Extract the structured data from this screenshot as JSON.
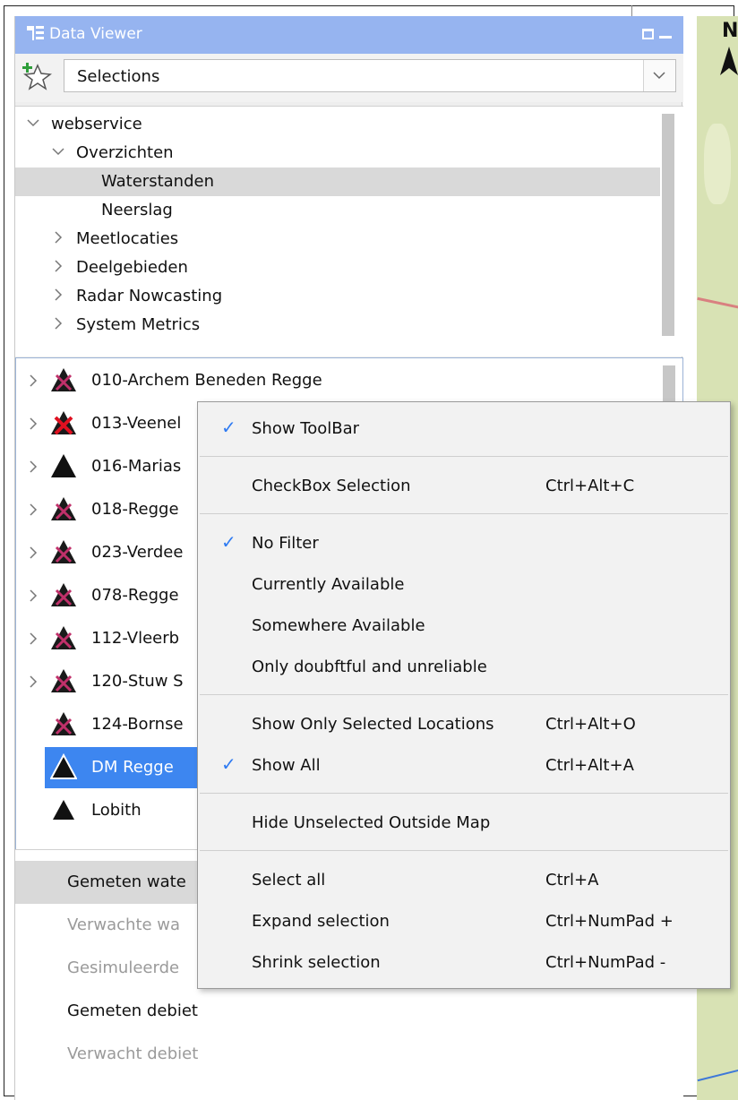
{
  "panel": {
    "title": "Data Viewer",
    "selector_value": "Selections"
  },
  "tree": [
    {
      "label": "webservice",
      "expanded": true
    },
    {
      "label": "Overzichten",
      "expanded": true
    },
    {
      "label": "Waterstanden",
      "selected": true
    },
    {
      "label": "Neerslag"
    },
    {
      "label": "Meetlocaties",
      "expanded": false
    },
    {
      "label": "Deelgebieden",
      "expanded": false
    },
    {
      "label": "Radar Nowcasting",
      "expanded": false
    },
    {
      "label": "System Metrics",
      "expanded": false
    }
  ],
  "locations": [
    {
      "label": "010-Archem Beneden Regge",
      "icon": "dark-triangle-icon"
    },
    {
      "label": "013-Veenel",
      "icon": "red-cross-triangle-icon"
    },
    {
      "label": "016-Marias",
      "icon": "black-triangle-icon"
    },
    {
      "label": "018-Regge",
      "icon": "dark-triangle-icon"
    },
    {
      "label": "023-Verdee",
      "icon": "dark-triangle-icon"
    },
    {
      "label": "078-Regge",
      "icon": "dark-triangle-icon"
    },
    {
      "label": "112-Vleerb",
      "icon": "dark-triangle-icon"
    },
    {
      "label": "120-Stuw S",
      "icon": "dark-triangle-icon"
    },
    {
      "label": "124-Bornse",
      "icon": "dark-triangle-icon"
    },
    {
      "label": "DM Regge",
      "icon": "black-triangle-icon",
      "selected": true
    },
    {
      "label": "Lobith",
      "icon": "black-triangle-icon"
    }
  ],
  "parameters": [
    {
      "label": "Gemeten wate",
      "selected": true
    },
    {
      "label": "Verwachte wa",
      "dimmed": true
    },
    {
      "label": "Gesimuleerde",
      "dimmed": true
    },
    {
      "label": "Gemeten debiet"
    },
    {
      "label": "Verwacht debiet",
      "dimmed": true
    }
  ],
  "map": {
    "north_label": "N"
  },
  "context_menu": {
    "checkmark": "✓",
    "items": [
      {
        "label": "Show ToolBar",
        "shortcut": "",
        "checked": true
      },
      {
        "label": "CheckBox Selection",
        "shortcut": "Ctrl+Alt+C",
        "checked": false
      },
      {
        "label": "No Filter",
        "shortcut": "",
        "checked": true
      },
      {
        "label": "Currently Available",
        "shortcut": "",
        "checked": false
      },
      {
        "label": "Somewhere Available",
        "shortcut": "",
        "checked": false
      },
      {
        "label": "Only doubftful and unreliable",
        "shortcut": "",
        "checked": false
      },
      {
        "label": "Show Only Selected Locations",
        "shortcut": "Ctrl+Alt+O",
        "checked": false
      },
      {
        "label": "Show All",
        "shortcut": "Ctrl+Alt+A",
        "checked": true
      },
      {
        "label": "Hide Unselected Outside Map",
        "shortcut": "",
        "checked": false
      },
      {
        "label": "Select all",
        "shortcut": "Ctrl+A",
        "checked": false
      },
      {
        "label": "Expand selection",
        "shortcut": "Ctrl+NumPad +",
        "checked": false
      },
      {
        "label": "Shrink selection",
        "shortcut": "Ctrl+NumPad -",
        "checked": false
      }
    ]
  },
  "colors": {
    "title_bar": "#96b4f0",
    "selection": "#3d86f0",
    "check": "#2f7bf2"
  }
}
